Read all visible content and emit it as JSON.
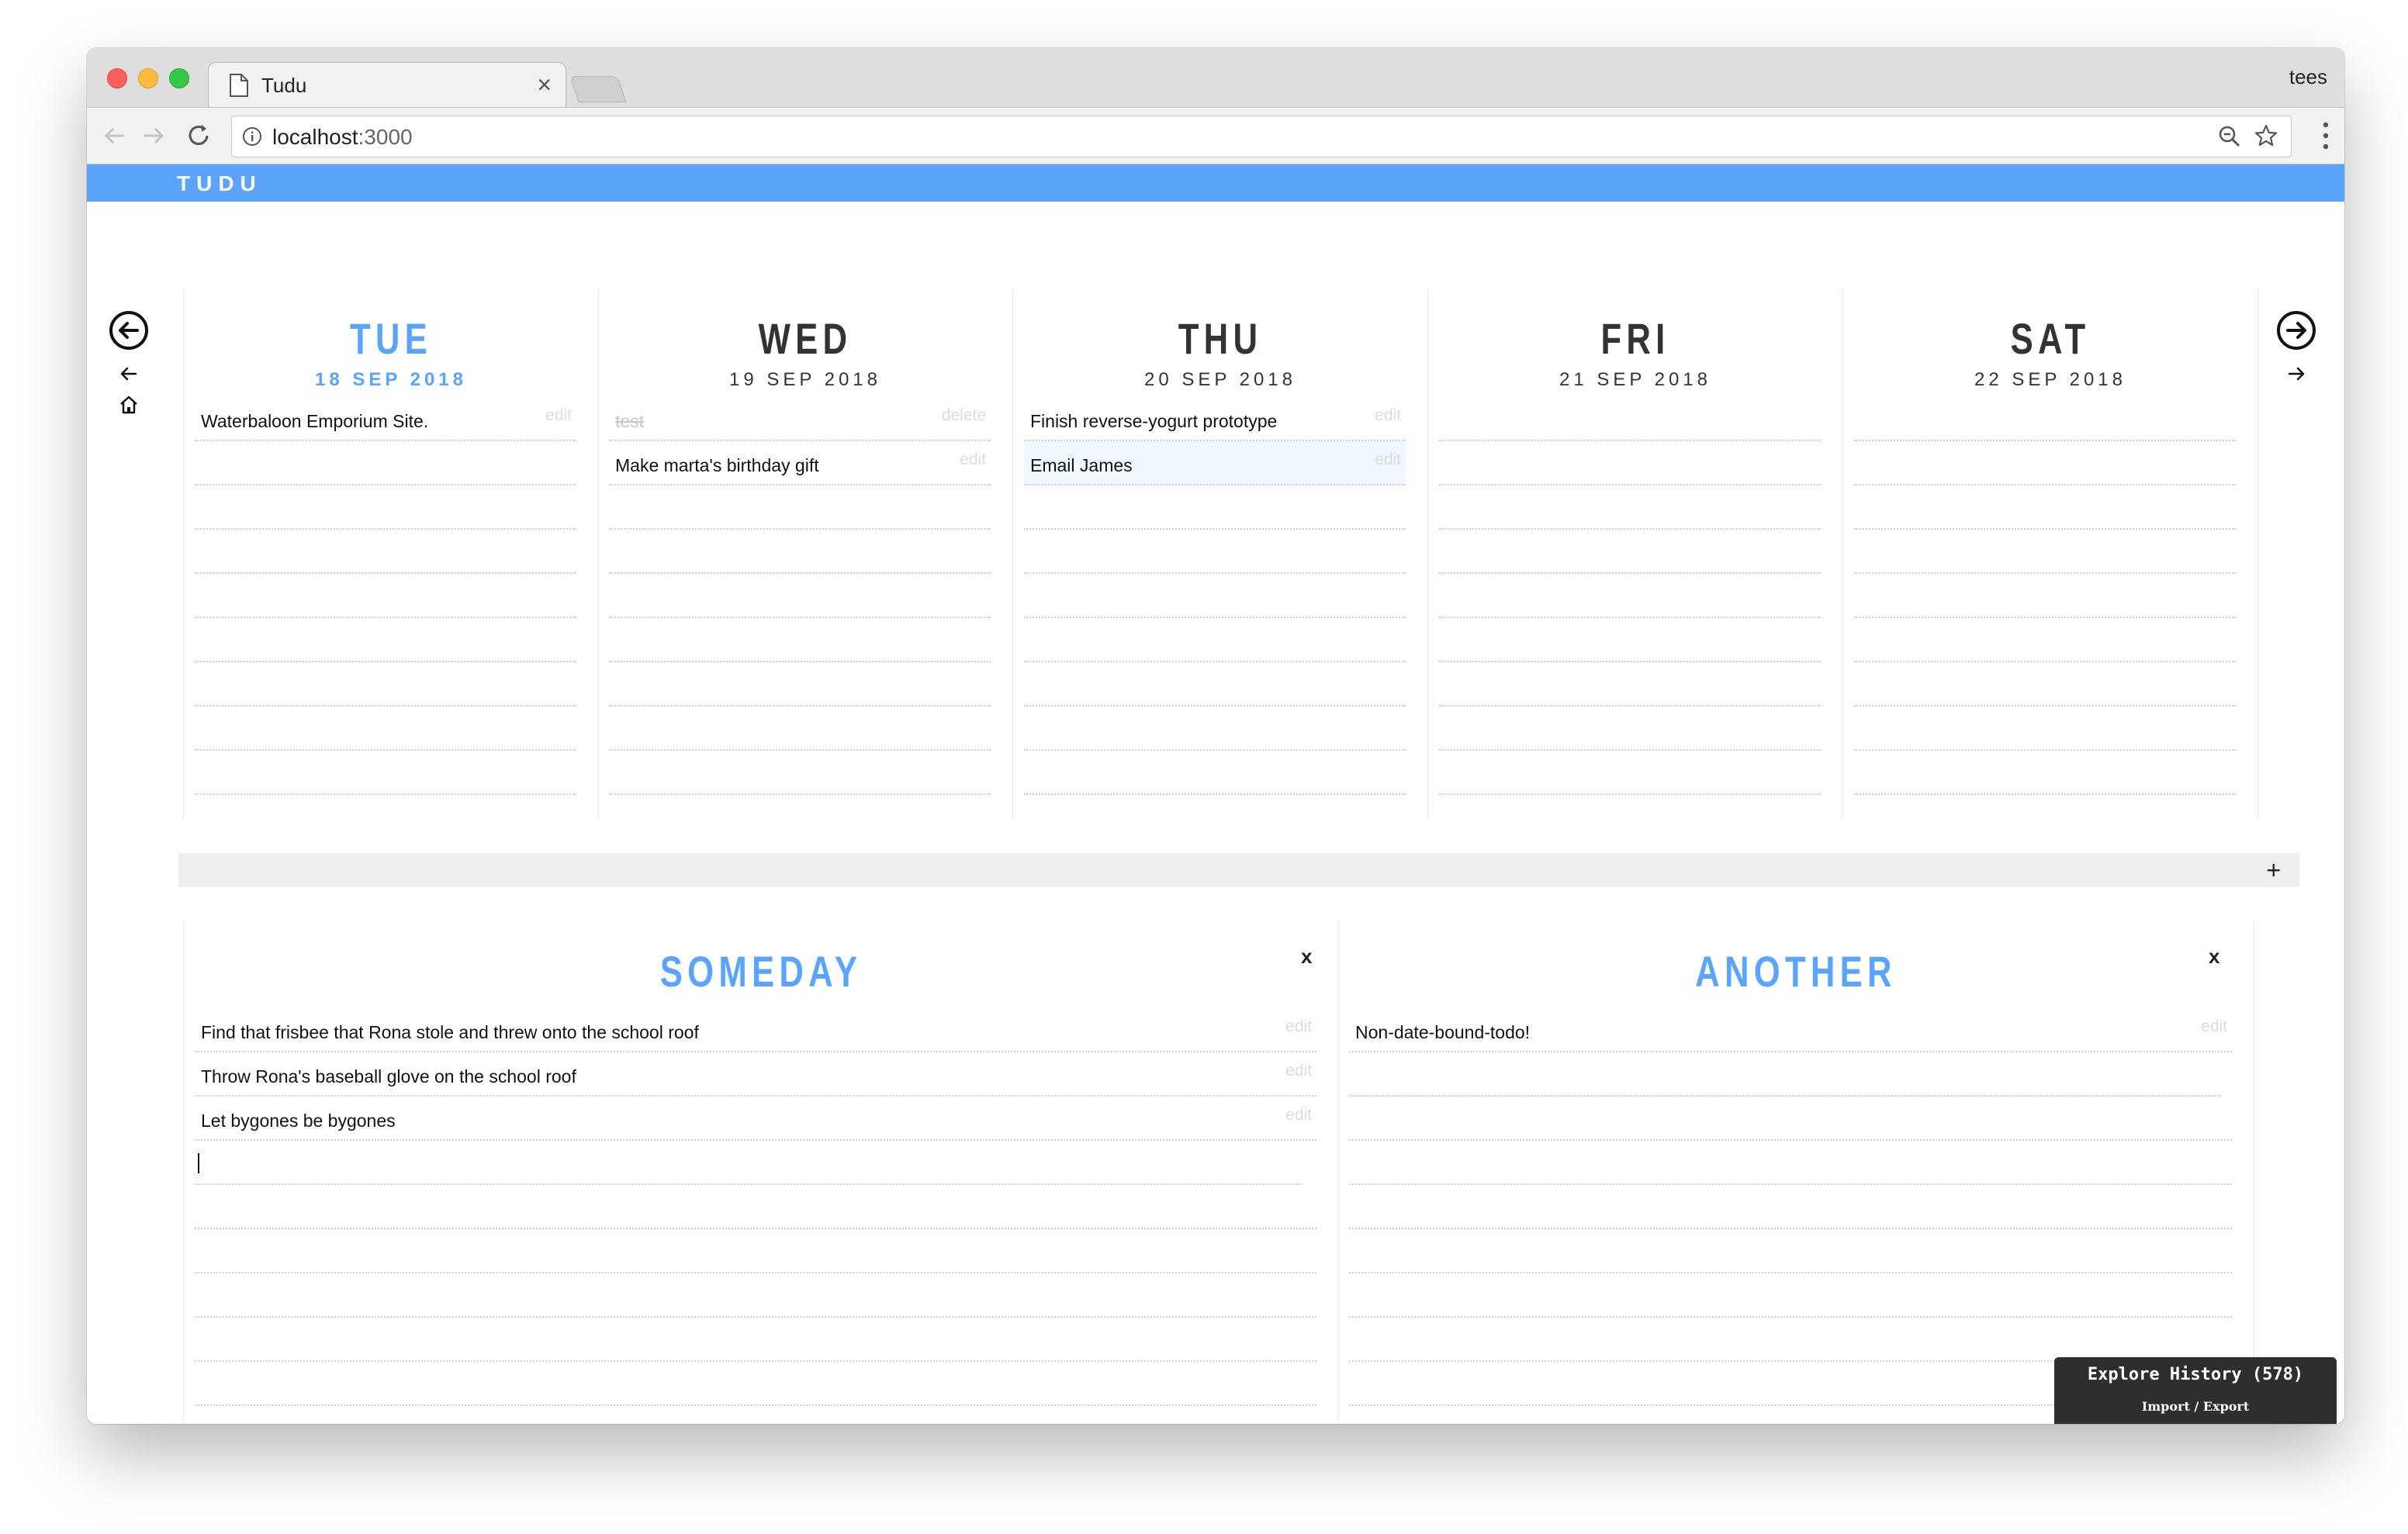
{
  "browser": {
    "tab_title": "Tudu",
    "profile": "tees",
    "url_host": "localhost",
    "url_port": ":3000"
  },
  "app": {
    "title": "TUDU",
    "accent_color": "#5ba4fc"
  },
  "days": [
    {
      "name": "TUE",
      "date": "18 SEP 2018",
      "today": true,
      "items": [
        {
          "text": "Waterbaloon Emporium Site.",
          "action": "edit",
          "done": false
        }
      ]
    },
    {
      "name": "WED",
      "date": "19 SEP 2018",
      "today": false,
      "items": [
        {
          "text": "test",
          "action": "delete",
          "done": true
        },
        {
          "text": "Make marta's birthday gift",
          "action": "edit",
          "done": false
        }
      ]
    },
    {
      "name": "THU",
      "date": "20 SEP 2018",
      "today": false,
      "items": [
        {
          "text": "Finish reverse-yogurt prototype",
          "action": "edit",
          "done": false
        },
        {
          "text": "Email James",
          "action": "edit",
          "done": false,
          "active": true
        }
      ]
    },
    {
      "name": "FRI",
      "date": "21 SEP 2018",
      "today": false,
      "items": []
    },
    {
      "name": "SAT",
      "date": "22 SEP 2018",
      "today": false,
      "items": []
    }
  ],
  "add_list_label": "+",
  "lists": [
    {
      "title": "SOMEDAY",
      "close": "x",
      "items": [
        {
          "text": "Find that frisbee that Rona stole and threw onto the school roof",
          "action": "edit"
        },
        {
          "text": "Throw Rona's baseball glove on the school roof",
          "action": "edit"
        },
        {
          "text": "Let bygones be bygones",
          "action": "edit"
        }
      ]
    },
    {
      "title": "ANOTHER",
      "close": "x",
      "items": [
        {
          "text": "Non-date-bound-todo!",
          "action": "edit"
        }
      ]
    }
  ],
  "history": {
    "title": "Explore History (578)",
    "import": "Import",
    "separator": "/",
    "export": "Export"
  }
}
